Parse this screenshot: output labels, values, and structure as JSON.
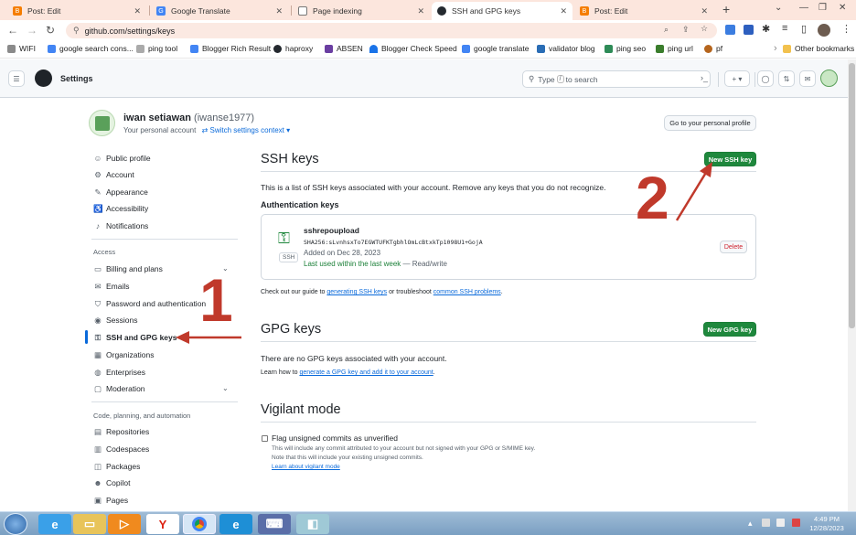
{
  "browser": {
    "tabs": [
      {
        "title": "Post: Edit",
        "icon": "blogger-icon",
        "color": "#f57d00"
      },
      {
        "title": "Google Translate",
        "icon": "translate-icon",
        "color": "#4285f4"
      },
      {
        "title": "Page indexing",
        "icon": "search-console-icon",
        "color": "#6c6c6c"
      },
      {
        "title": "SSH and GPG keys",
        "icon": "github-icon",
        "color": "#24292f"
      },
      {
        "title": "Post: Edit",
        "icon": "blogger-icon",
        "color": "#f57d00"
      }
    ],
    "new_tab": "+",
    "url": "github.com/settings/keys",
    "bookmarks": [
      {
        "label": "WIFI",
        "color": "#555"
      },
      {
        "label": "google search cons...",
        "color": "#4285f4"
      },
      {
        "label": "ping tool",
        "color": "#888"
      },
      {
        "label": "Blogger Rich Result",
        "color": "#4285f4"
      },
      {
        "label": "haproxy",
        "color": "#24292f"
      },
      {
        "label": "ABSEN",
        "color": "#6a3ea1"
      },
      {
        "label": "Blogger Check Speed",
        "color": "#1a73e8"
      },
      {
        "label": "google translate",
        "color": "#4285f4"
      },
      {
        "label": "validator blog",
        "color": "#2a6db5"
      },
      {
        "label": "ping seo",
        "color": "#2e8b57"
      },
      {
        "label": "ping url",
        "color": "#3a7d2c"
      },
      {
        "label": "pf",
        "color": "#b5651d"
      }
    ],
    "other_bookmarks": "Other bookmarks"
  },
  "github": {
    "header_title": "Settings",
    "search_prefix": "Type",
    "search_key": "/",
    "search_suffix": "to search",
    "user": {
      "name": "iwan setiawan",
      "handle": "(iwanse1977)",
      "subtitle": "Your personal account",
      "switch": "Switch settings context",
      "profile_button": "Go to your personal profile"
    },
    "nav_top": [
      {
        "label": "Public profile",
        "icon": "person-icon",
        "glyph": "☺"
      },
      {
        "label": "Account",
        "icon": "gear-icon",
        "glyph": "⚙"
      },
      {
        "label": "Appearance",
        "icon": "paintbrush-icon",
        "glyph": "✎"
      },
      {
        "label": "Accessibility",
        "icon": "accessibility-icon",
        "glyph": "♿"
      },
      {
        "label": "Notifications",
        "icon": "bell-icon",
        "glyph": "♪"
      }
    ],
    "access_header": "Access",
    "nav_access": [
      {
        "label": "Billing and plans",
        "icon": "credit-card-icon",
        "glyph": "▭",
        "chevron": true
      },
      {
        "label": "Emails",
        "icon": "mail-icon",
        "glyph": "✉"
      },
      {
        "label": "Password and authentication",
        "icon": "shield-lock-icon",
        "glyph": "⛉"
      },
      {
        "label": "Sessions",
        "icon": "broadcast-icon",
        "glyph": "◉"
      },
      {
        "label": "SSH and GPG keys",
        "icon": "key-icon",
        "glyph": "⚿",
        "active": true
      },
      {
        "label": "Organizations",
        "icon": "organization-icon",
        "glyph": "▦"
      },
      {
        "label": "Enterprises",
        "icon": "globe-icon",
        "glyph": "◍"
      },
      {
        "label": "Moderation",
        "icon": "report-icon",
        "glyph": "▢",
        "chevron": true
      }
    ],
    "code_header": "Code, planning, and automation",
    "nav_code": [
      {
        "label": "Repositories",
        "icon": "repo-icon",
        "glyph": "▤"
      },
      {
        "label": "Codespaces",
        "icon": "codespaces-icon",
        "glyph": "▥"
      },
      {
        "label": "Packages",
        "icon": "package-icon",
        "glyph": "◫"
      },
      {
        "label": "Copilot",
        "icon": "copilot-icon",
        "glyph": "☻"
      },
      {
        "label": "Pages",
        "icon": "browser-icon",
        "glyph": "▣"
      }
    ],
    "ssh": {
      "title": "SSH keys",
      "new_button": "New SSH key",
      "description": "This is a list of SSH keys associated with your account. Remove any keys that you do not recognize.",
      "auth_header": "Authentication keys",
      "key": {
        "name": "sshrepoupload",
        "fingerprint": "SHA256:sLvnhsxTo7EGWTUFKTgbhlOmLcBtxkTp1098U1+GojA",
        "added": "Added on Dec 28, 2023",
        "last_used": "Last used within the last week",
        "access": "— Read/write",
        "badge": "SSH",
        "delete": "Delete"
      },
      "guide_pre": "Check out our guide to",
      "guide_link1": "generating SSH keys",
      "guide_mid": "or troubleshoot",
      "guide_link2": "common SSH problems",
      "guide_end": "."
    },
    "gpg": {
      "title": "GPG keys",
      "new_button": "New GPG key",
      "empty": "There are no GPG keys associated with your account.",
      "learn_pre": "Learn how to",
      "learn_link": "generate a GPG key and add it to your account",
      "learn_end": "."
    },
    "vigilant": {
      "title": "Vigilant mode",
      "checkbox_label": "Flag unsigned commits as unverified",
      "help1": "This will include any commit attributed to your account but not signed with your GPG or S/MIME key.",
      "help2": "Note that this will include your existing unsigned commits.",
      "link": "Learn about vigilant mode"
    }
  },
  "annotations": {
    "marker1": "1",
    "marker2": "2",
    "color": "#c0392b"
  },
  "taskbar": {
    "time": "4:49 PM",
    "date": "12/28/2023"
  }
}
